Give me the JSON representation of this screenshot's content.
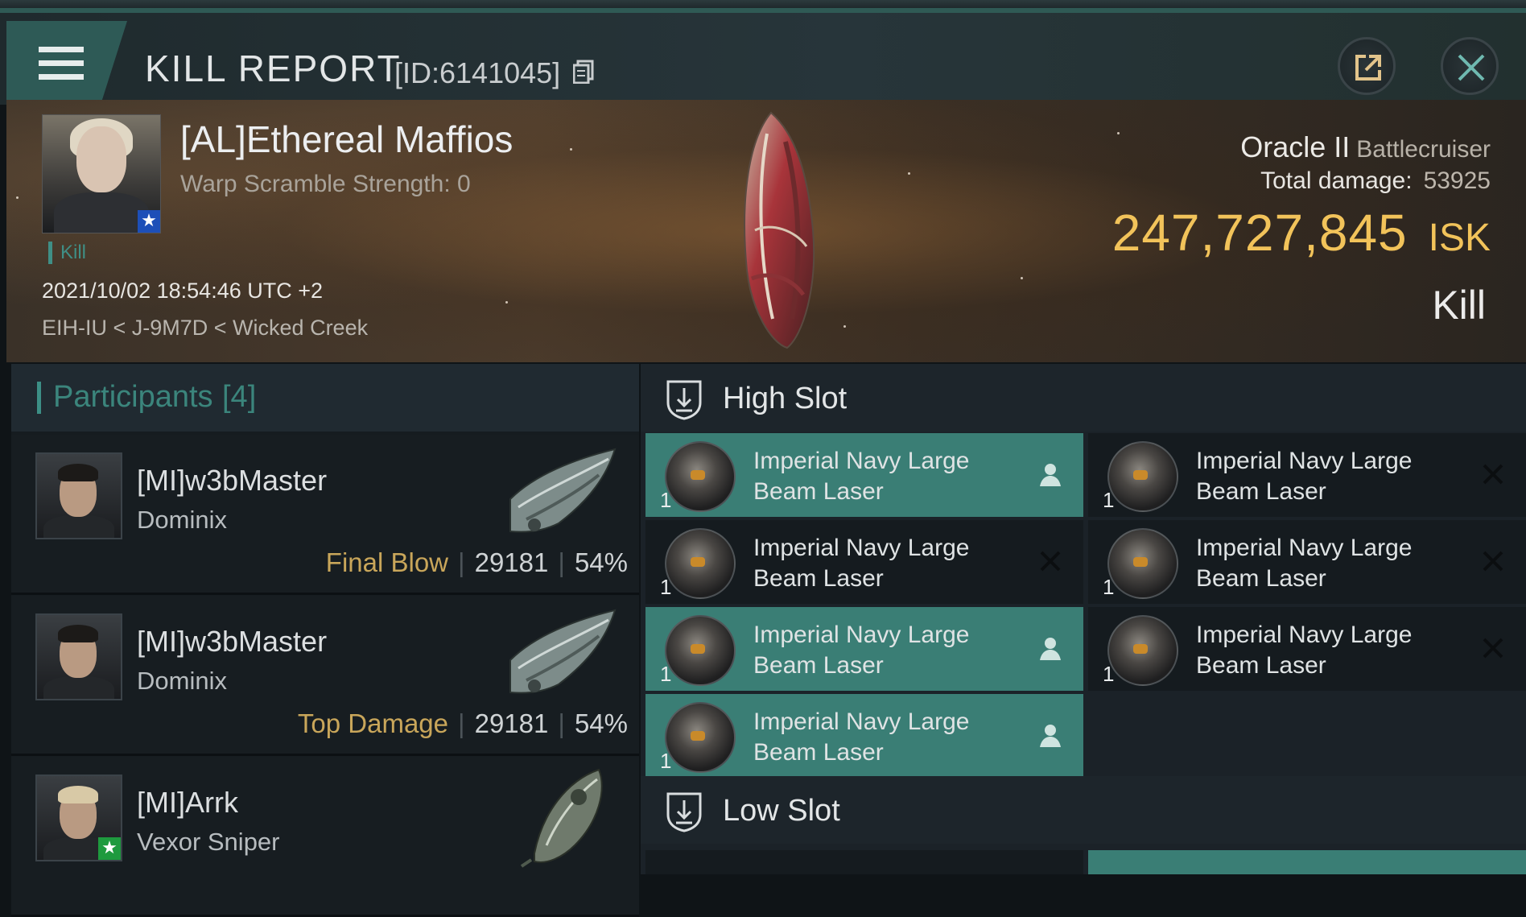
{
  "header": {
    "title": "KILL REPORT",
    "id_label": "[ID:6141045]"
  },
  "victim": {
    "name": "[AL]Ethereal Maffios",
    "warp_scramble": "Warp Scramble Strength: 0",
    "tag": "Kill",
    "timestamp": "2021/10/02 18:54:46 UTC +2",
    "location": "EIH-IU < J-9M7D < Wicked Creek",
    "ship_name": "Oracle II",
    "ship_class": "Battlecruiser",
    "total_damage_label": "Total damage:",
    "total_damage": "53925",
    "isk_value": "247,727,845",
    "isk_unit": "ISK",
    "result": "Kill"
  },
  "participants": {
    "label": "Participants",
    "count": "[4]",
    "items": [
      {
        "name": "[MI]w3bMaster",
        "ship": "Dominix",
        "tag": "Final Blow",
        "damage": "29181",
        "percent": "54%"
      },
      {
        "name": "[MI]w3bMaster",
        "ship": "Dominix",
        "tag": "Top Damage",
        "damage": "29181",
        "percent": "54%"
      },
      {
        "name": "[MI]Arrk",
        "ship": "Vexor Sniper",
        "tag": "",
        "damage": "",
        "percent": ""
      }
    ]
  },
  "slots": {
    "high_label": "High Slot",
    "low_label": "Low Slot",
    "high_items": [
      {
        "line1": "Imperial Navy Large",
        "line2": "Beam Laser",
        "qty": "1",
        "state": "fitted",
        "status_icon": "pilot-icon"
      },
      {
        "line1": "Imperial Navy Large",
        "line2": "Beam Laser",
        "qty": "1",
        "state": "destroyed",
        "status_icon": "destroyed-x-icon"
      },
      {
        "line1": "Imperial Navy Large",
        "line2": "Beam Laser",
        "qty": "1",
        "state": "destroyed",
        "status_icon": "destroyed-x-icon"
      },
      {
        "line1": "Imperial Navy Large",
        "line2": "Beam Laser",
        "qty": "1",
        "state": "destroyed",
        "status_icon": "destroyed-x-icon"
      },
      {
        "line1": "Imperial Navy Large",
        "line2": "Beam Laser",
        "qty": "1",
        "state": "fitted",
        "status_icon": "pilot-icon"
      },
      {
        "line1": "Imperial Navy Large",
        "line2": "Beam Laser",
        "qty": "1",
        "state": "destroyed",
        "status_icon": "destroyed-x-icon"
      },
      {
        "line1": "Imperial Navy Large",
        "line2": "Beam Laser",
        "qty": "1",
        "state": "fitted",
        "status_icon": "pilot-icon"
      }
    ]
  },
  "colors": {
    "accent_teal": "#3a7e75",
    "isk_gold": "#f2c35a",
    "tag_gold": "#c9a65a",
    "kill_tag_teal": "#3f8f86"
  }
}
